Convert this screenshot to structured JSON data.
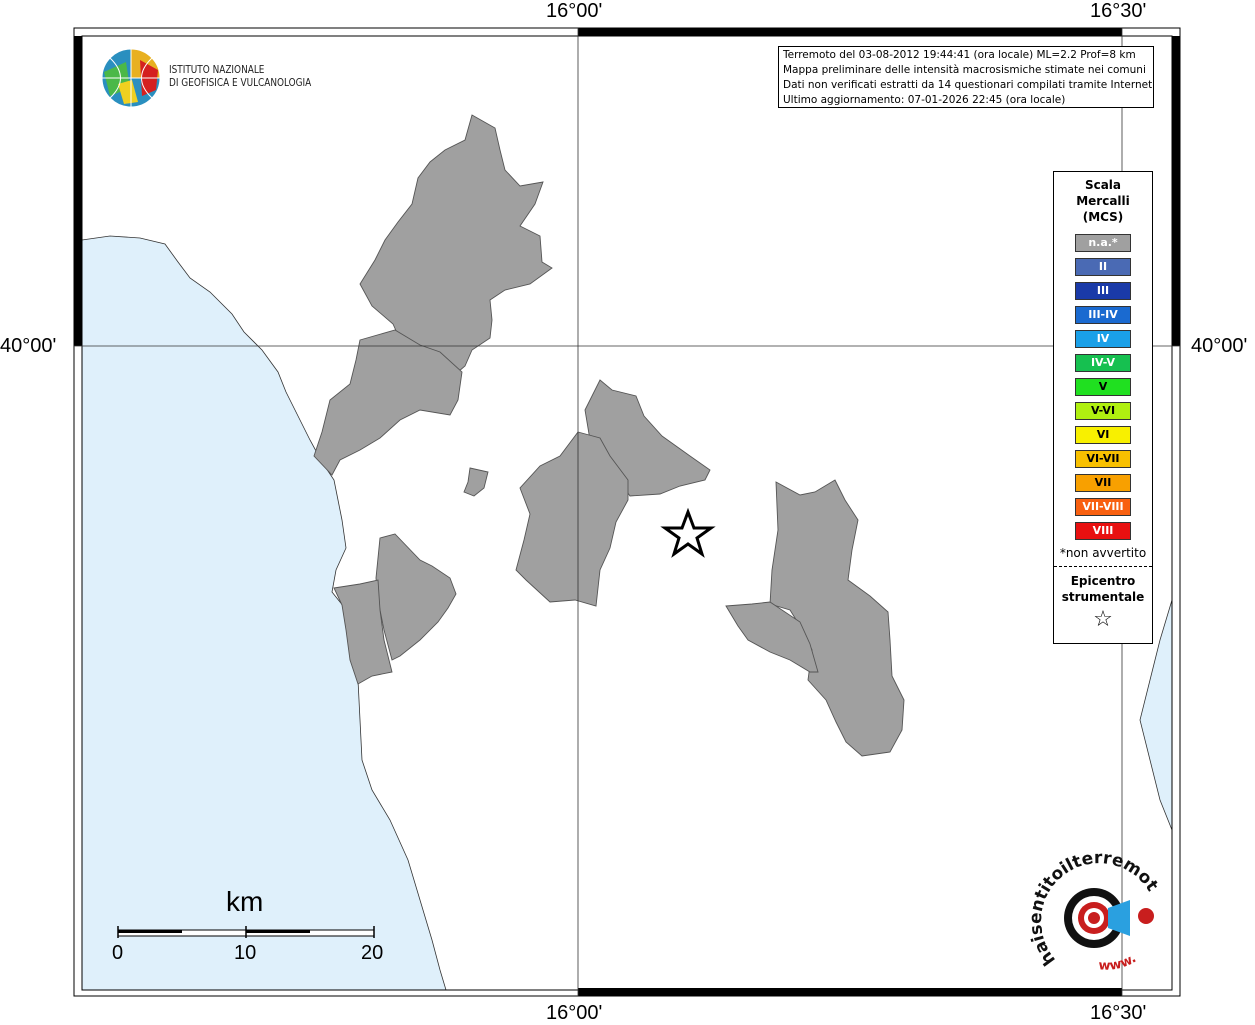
{
  "map": {
    "lon_labels": [
      "16°00'",
      "16°30'"
    ],
    "lat_labels": [
      "40°00'"
    ],
    "lon_ticks": [
      16.0,
      16.5
    ],
    "lat_ticks": [
      40.0
    ]
  },
  "logo": {
    "line1": "ISTITUTO NAZIONALE",
    "line2": "DI GEOFISICA E VULCANOLOGIA"
  },
  "info": {
    "line1": "Terremoto del 03-08-2012 19:44:41 (ora locale) ML=2.2 Prof=8 km",
    "line2": "Mappa preliminare delle intensità macrosismiche stimate nei comuni",
    "line3": "Dati non verificati estratti da 14 questionari compilati tramite Internet.",
    "line4": "Ultimo aggiornamento: 07-01-2026 22:45 (ora locale)"
  },
  "legend": {
    "title1": "Scala",
    "title2": "Mercalli",
    "title3": "(MCS)",
    "items": [
      {
        "label": "n.a.*",
        "color": "#a0a0a0"
      },
      {
        "label": "II",
        "color": "#4a6ab4"
      },
      {
        "label": "III",
        "color": "#1a3aa8"
      },
      {
        "label": "III-IV",
        "color": "#1a6ad0"
      },
      {
        "label": "IV",
        "color": "#1aa0e8"
      },
      {
        "label": "IV-V",
        "color": "#16c050"
      },
      {
        "label": "V",
        "color": "#20e020"
      },
      {
        "label": "V-VI",
        "color": "#b0f010"
      },
      {
        "label": "VI",
        "color": "#f8f000"
      },
      {
        "label": "VI-VII",
        "color": "#f8c000"
      },
      {
        "label": "VII",
        "color": "#f8a000"
      },
      {
        "label": "VII-VIII",
        "color": "#f86010"
      },
      {
        "label": "VIII",
        "color": "#e81010"
      }
    ],
    "note": "*non avvertito",
    "epicentre1": "Epicentro",
    "epicentre2": "strumentale"
  },
  "scale_bar": {
    "unit": "km",
    "ticks": [
      "0",
      "10",
      "20"
    ]
  },
  "watermark": {
    "text": "haisentitoilterremoto.it",
    "prefix": "www."
  },
  "colors": {
    "sea": "#dff0fb",
    "municipality": "#a0a0a0"
  }
}
